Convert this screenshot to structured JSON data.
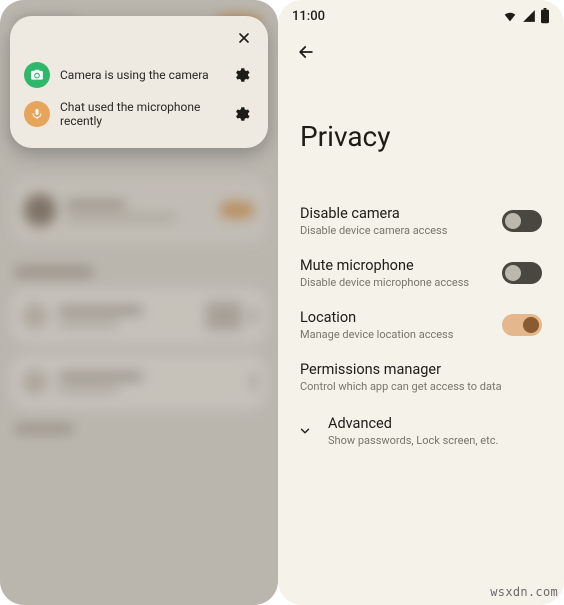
{
  "left": {
    "popup": {
      "rows": [
        {
          "icon": "camera-icon",
          "icon_color": "green",
          "label": "Camera is using the camera"
        },
        {
          "icon": "microphone-icon",
          "icon_color": "orange",
          "label": "Chat used the microphone recently"
        }
      ]
    }
  },
  "right": {
    "status": {
      "time": "11:00"
    },
    "title": "Privacy",
    "settings": [
      {
        "key": "disable_camera",
        "title": "Disable camera",
        "subtitle": "Disable device camera access",
        "toggle": "off"
      },
      {
        "key": "mute_microphone",
        "title": "Mute microphone",
        "subtitle": "Disable device microphone access",
        "toggle": "off"
      },
      {
        "key": "location",
        "title": "Location",
        "subtitle": "Manage device location access",
        "toggle": "on"
      },
      {
        "key": "permissions_manager",
        "title": "Permissions manager",
        "subtitle": "Control which app can get access to data",
        "toggle": null
      }
    ],
    "advanced": {
      "title": "Advanced",
      "subtitle": "Show passwords, Lock screen, etc."
    }
  },
  "watermark": "wsxdn.com"
}
